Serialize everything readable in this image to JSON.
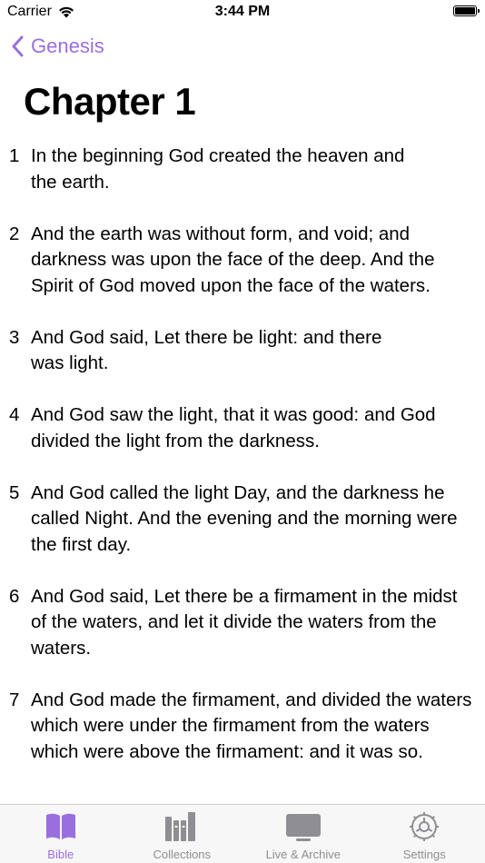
{
  "status_bar": {
    "carrier": "Carrier",
    "time": "3:44 PM"
  },
  "nav": {
    "back_label": "Genesis"
  },
  "chapter": {
    "title": "Chapter 1"
  },
  "verses": [
    {
      "num": "1",
      "text": "In the beginning God created the heaven and the earth."
    },
    {
      "num": "2",
      "text": "And the earth was without form, and void; and darkness was upon the face of the deep. And the Spirit of God moved upon the face of the waters."
    },
    {
      "num": "3",
      "text": "And God said, Let there be light: and there was light."
    },
    {
      "num": "4",
      "text": "And God saw the light, that it was good: and God divided the light from the darkness."
    },
    {
      "num": "5",
      "text": "And God called the light Day, and the darkness he called Night. And the evening and the morning were the first day."
    },
    {
      "num": "6",
      "text": "And God said, Let there be a firmament in the midst of the waters, and let it divide the waters from the waters."
    },
    {
      "num": "7",
      "text": "And God made the firmament, and divided the waters which were under the firmament from the waters which were above the firmament: and it was so."
    }
  ],
  "tab_bar": {
    "tabs": [
      {
        "label": "Bible",
        "icon": "open-book-icon",
        "active": true
      },
      {
        "label": "Collections",
        "icon": "books-icon",
        "active": false
      },
      {
        "label": "Live & Archive",
        "icon": "display-icon",
        "active": false
      },
      {
        "label": "Settings",
        "icon": "gear-icon",
        "active": false
      }
    ]
  },
  "colors": {
    "accent": "#9b6ee0",
    "inactive": "#8e8e93"
  }
}
